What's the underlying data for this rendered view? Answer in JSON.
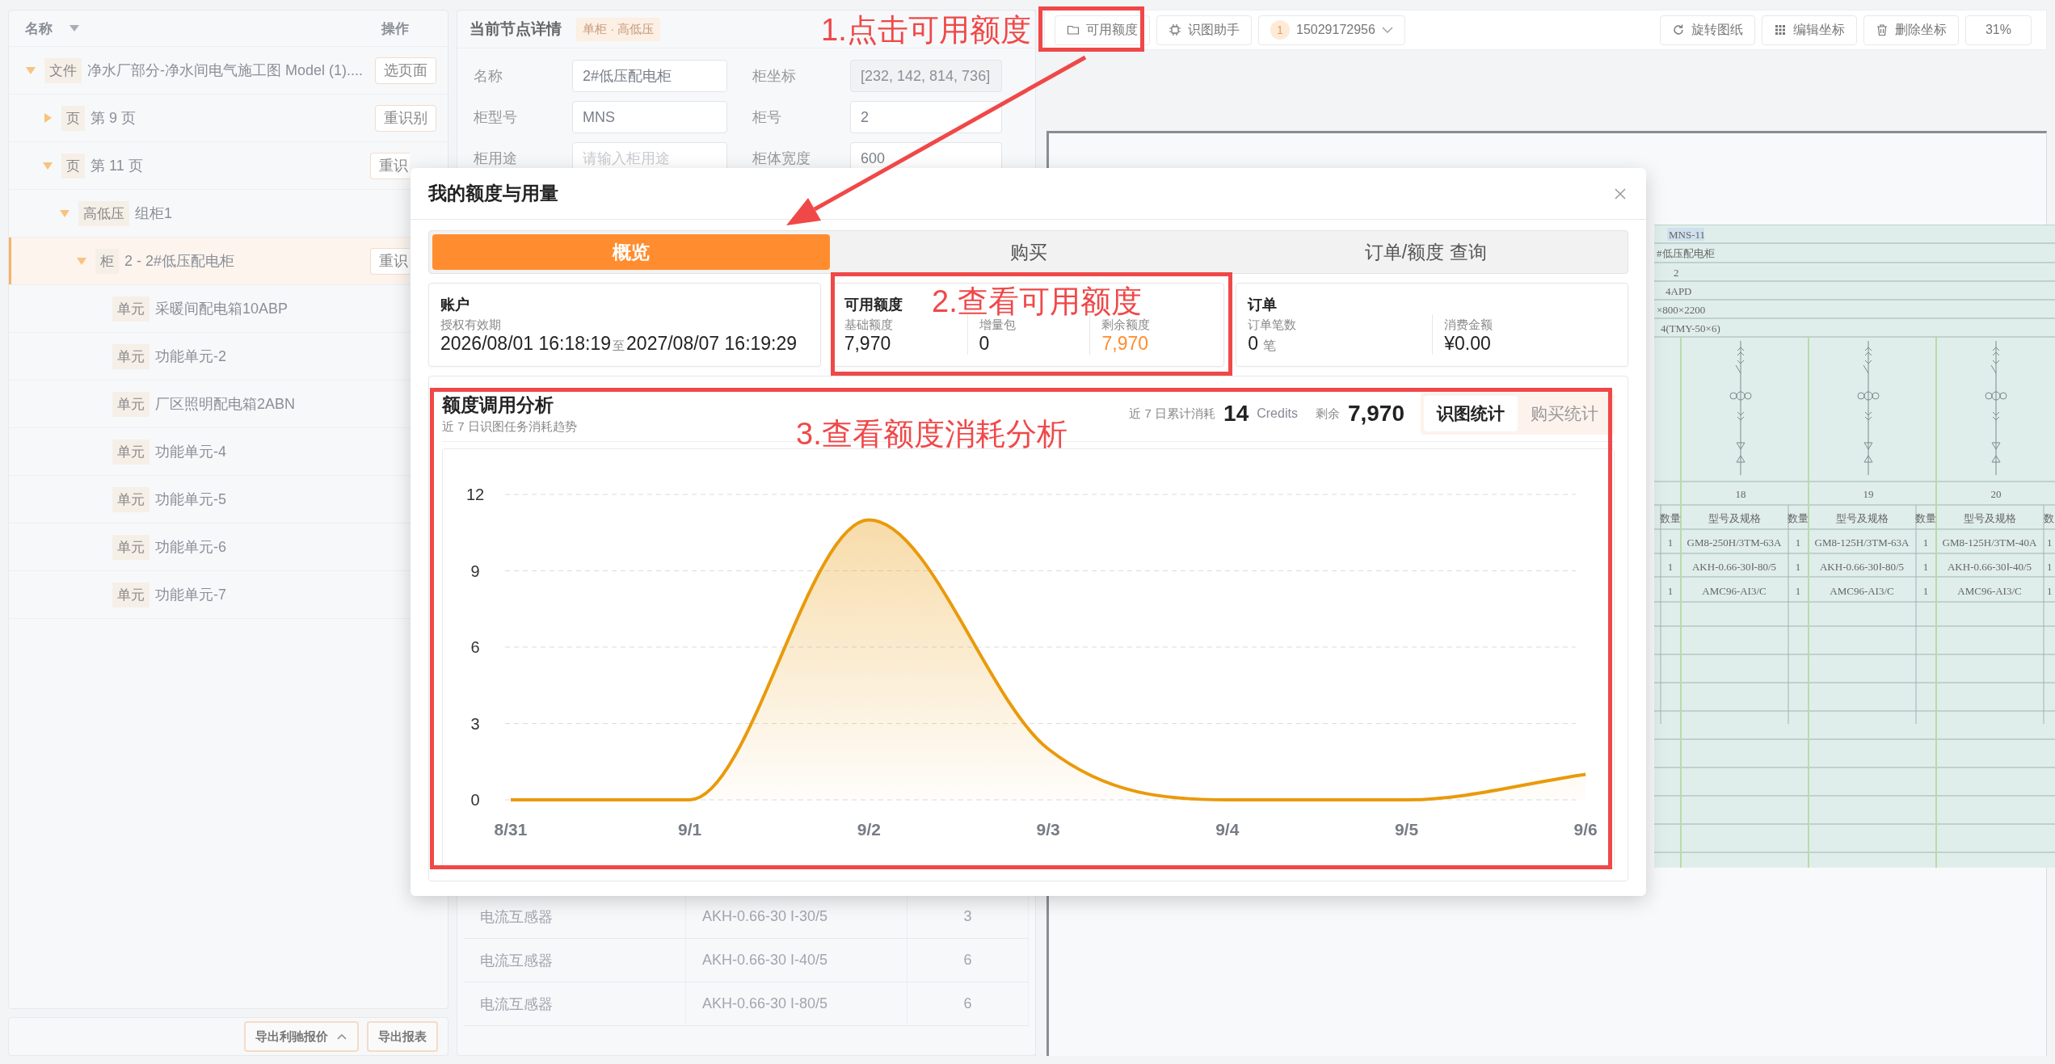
{
  "tree": {
    "header": {
      "name": "名称",
      "action": "操作"
    },
    "items": [
      {
        "tag": "文件",
        "label": "净水厂部分-净水间电气施工图 Model (1)....",
        "expanded": true,
        "selected": false,
        "action": "选页面",
        "children": [
          {
            "tag": "页",
            "label": "第 9 页",
            "expanded": false,
            "selected": false,
            "action": "重识别"
          },
          {
            "tag": "页",
            "label": "第 11 页",
            "expanded": true,
            "selected": false,
            "action": "重识",
            "children": [
              {
                "tag": "高低压",
                "label": "组柜1",
                "expanded": true,
                "selected": false,
                "children": [
                  {
                    "tag": "柜",
                    "label": "2 - 2#低压配电柜",
                    "expanded": true,
                    "selected": true,
                    "action": "重识",
                    "children": [
                      {
                        "tag": "单元",
                        "label": "采暖间配电箱10ABP",
                        "selected": false
                      },
                      {
                        "tag": "单元",
                        "label": "功能单元-2",
                        "selected": false
                      },
                      {
                        "tag": "单元",
                        "label": "厂区照明配电箱2ABN",
                        "selected": false
                      },
                      {
                        "tag": "单元",
                        "label": "功能单元-4",
                        "selected": false
                      },
                      {
                        "tag": "单元",
                        "label": "功能单元-5",
                        "selected": false
                      },
                      {
                        "tag": "单元",
                        "label": "功能单元-6",
                        "selected": false
                      },
                      {
                        "tag": "单元",
                        "label": "功能单元-7",
                        "selected": false
                      }
                    ]
                  }
                ]
              }
            ]
          }
        ]
      }
    ],
    "footer_buttons": [
      {
        "label": "导出利驰报价",
        "menu": true
      },
      {
        "label": "导出报表",
        "menu": false
      }
    ]
  },
  "details": {
    "title": "当前节点详情",
    "tag": "单柜 · 高低压",
    "fields": [
      {
        "label": "名称",
        "value": "2#低压配电柜",
        "disabled": false
      },
      {
        "label": "柜坐标",
        "value": "[232, 142, 814, 736]",
        "disabled": true
      },
      {
        "label": "柜型号",
        "value": "MNS",
        "disabled": false
      },
      {
        "label": "柜号",
        "value": "2",
        "disabled": false
      },
      {
        "label": "柜用途",
        "placeholder": "请输入柜用途",
        "disabled": false
      },
      {
        "label": "柜体宽度",
        "value": "600",
        "disabled": false
      }
    ],
    "rows": [
      {
        "name": "电流互感器",
        "model": "AKH-0.66-30 I-30/5",
        "qty": "3"
      },
      {
        "name": "电流互感器",
        "model": "AKH-0.66-30 I-40/5",
        "qty": "6"
      },
      {
        "name": "电流互感器",
        "model": "AKH-0.66-30 I-80/5",
        "qty": "6"
      }
    ]
  },
  "toolbar": {
    "left": [
      {
        "kind": "button",
        "label": "可用额度"
      },
      {
        "kind": "button",
        "label": "识图助手"
      },
      {
        "kind": "user",
        "badge": "1",
        "label": "15029172956"
      }
    ],
    "right": [
      {
        "kind": "button",
        "label": "旋转图纸"
      },
      {
        "kind": "button",
        "label": "编辑坐标"
      },
      {
        "kind": "button",
        "label": "删除坐标"
      },
      {
        "kind": "zoom",
        "label": "31%"
      }
    ]
  },
  "drawing": {
    "info": [
      "MNS-11",
      "#低压配电柜",
      "2",
      "4APD",
      "×800×2200",
      "4(TMY-50×6)"
    ],
    "lead": {
      "header": "数量",
      "values": [
        "1",
        "1",
        "1"
      ]
    },
    "groups": [
      {
        "number": "18",
        "model_header": "型号及规格",
        "qty_header": "数量",
        "items": [
          {
            "model": "GM8-250H/3TM-63A",
            "qty": "1"
          },
          {
            "model": "AKH-0.66-30Ⅰ-80/5",
            "qty": "1"
          },
          {
            "model": "AMC96-AI3/C",
            "qty": "1"
          }
        ]
      },
      {
        "number": "19",
        "model_header": "型号及规格",
        "qty_header": "数量",
        "items": [
          {
            "model": "GM8-125H/3TM-63A",
            "qty": "1"
          },
          {
            "model": "AKH-0.66-30Ⅰ-80/5",
            "qty": "1"
          },
          {
            "model": "AMC96-AI3/C",
            "qty": "1"
          }
        ]
      },
      {
        "number": "20",
        "model_header": "型号及规格",
        "qty_header": "数",
        "items": [
          {
            "model": "GM8-125H/3TM-40A",
            "qty": "1"
          },
          {
            "model": "AKH-0.66-30Ⅰ-40/5",
            "qty": "1"
          },
          {
            "model": "AMC96-AI3/C",
            "qty": "1"
          }
        ]
      }
    ]
  },
  "modal": {
    "title": "我的额度与用量",
    "tabs": [
      {
        "label": "概览",
        "selected": true
      },
      {
        "label": "购买",
        "selected": false
      },
      {
        "label": "订单/额度 查询",
        "selected": false
      }
    ],
    "account": {
      "title": "账户",
      "label": "授权有效期",
      "start": "2026/08/01 16:18:19",
      "separator": "至",
      "end": "2027/08/07 16:19:29"
    },
    "quota": {
      "title": "可用额度",
      "items": [
        {
          "label": "基础额度",
          "value": "7,970",
          "highlight": false
        },
        {
          "label": "增量包",
          "value": "0",
          "highlight": false
        },
        {
          "label": "剩余额度",
          "value": "7,970",
          "highlight": true
        }
      ]
    },
    "orders": {
      "title": "订单",
      "items": [
        {
          "label": "订单笔数",
          "value": "0",
          "unit": "笔"
        },
        {
          "label": "消费金额",
          "value": "¥0.00"
        }
      ]
    },
    "analysis": {
      "title": "额度调用分析",
      "subtitle": "近 7 日识图任务消耗趋势",
      "used_label": "近 7 日累计消耗",
      "used": "14",
      "used_unit": "Credits",
      "remain_label": "剩余",
      "remain": "7,970",
      "toggles": [
        {
          "label": "识图统计",
          "selected": true
        },
        {
          "label": "购买统计",
          "selected": false
        }
      ],
      "chart_data": {
        "type": "area",
        "categories": [
          "8/31",
          "9/1",
          "9/2",
          "9/3",
          "9/4",
          "9/5",
          "9/6"
        ],
        "series": [
          {
            "color": "#e99a0b",
            "values": [
              0,
              0,
              11,
              2,
              0,
              0,
              1
            ]
          }
        ],
        "grid": true,
        "ylim": [
          0,
          12
        ],
        "yticks": [
          0,
          3,
          6,
          9,
          12
        ]
      }
    }
  },
  "annotations": [
    {
      "text": "1.点击可用额度"
    },
    {
      "text": "2.查看可用额度"
    },
    {
      "text": "3.查看额度消耗分析"
    }
  ]
}
